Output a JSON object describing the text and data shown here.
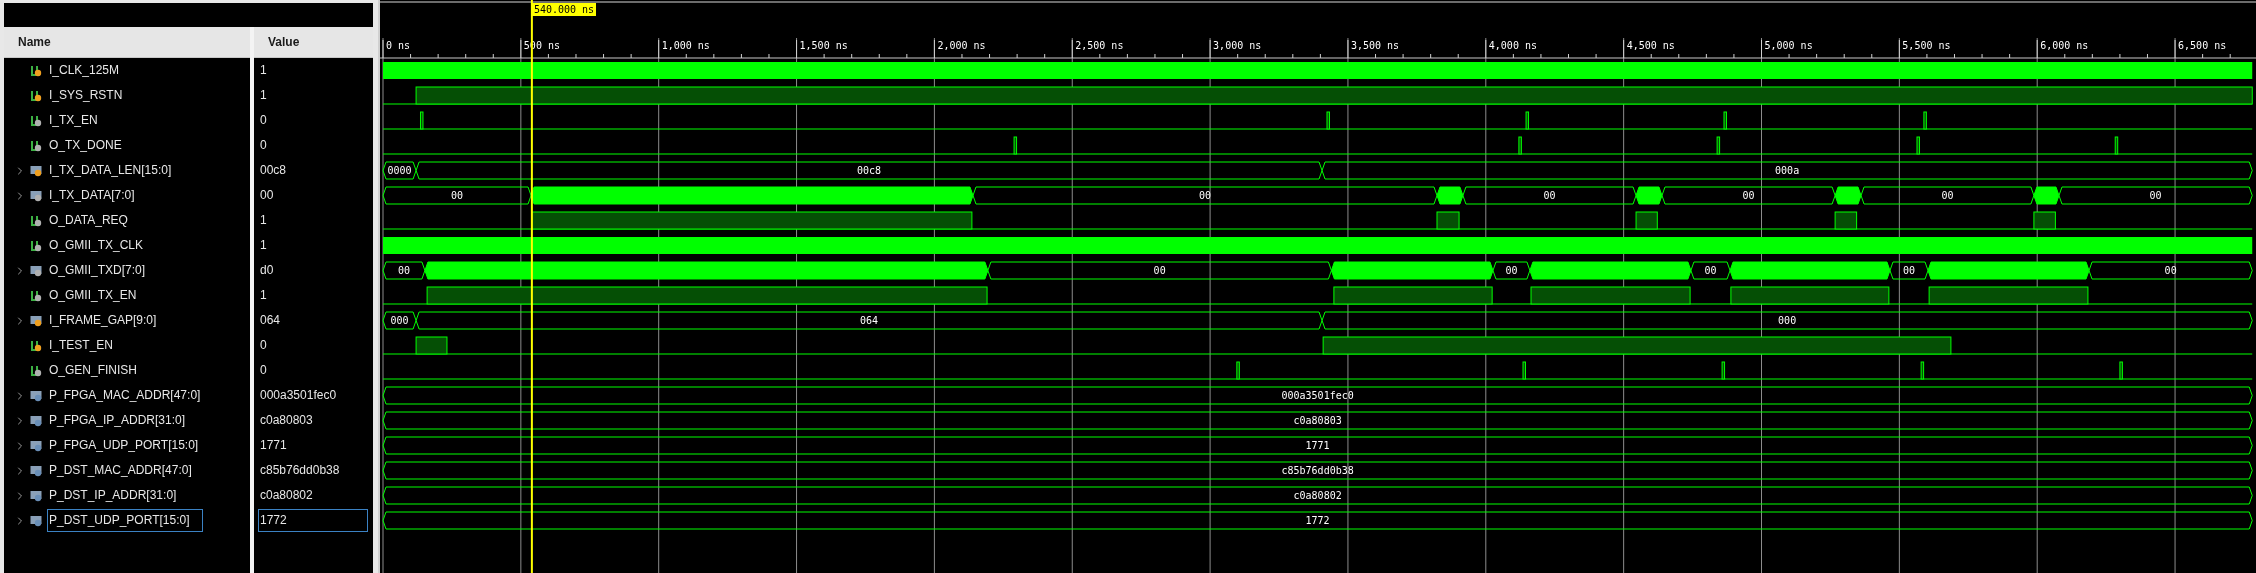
{
  "columns": {
    "name": "Name",
    "value": "Value"
  },
  "cursor": {
    "label": "540.000 ns"
  },
  "ruler": {
    "ticks": [
      "0 ns",
      "500 ns",
      "1,000 ns",
      "1,500 ns",
      "2,000 ns",
      "2,500 ns",
      "3,000 ns",
      "3,500 ns",
      "4,000 ns",
      "4,500 ns",
      "5,000 ns",
      "5,500 ns",
      "6,000 ns",
      "6,500 ns"
    ]
  },
  "signals": [
    {
      "name": "I_CLK_125M",
      "value": "1",
      "kind": "clock",
      "icon": {
        "kind": "input"
      },
      "selected": false
    },
    {
      "name": "I_SYS_RSTN",
      "value": "1",
      "kind": "bit",
      "icon": {
        "kind": "input"
      },
      "selected": false
    },
    {
      "name": "I_TX_EN",
      "value": "0",
      "kind": "bit",
      "icon": {
        "kind": "output"
      },
      "selected": false
    },
    {
      "name": "O_TX_DONE",
      "value": "0",
      "kind": "bit",
      "icon": {
        "kind": "output"
      },
      "selected": false
    },
    {
      "name": "I_TX_DATA_LEN[15:0]",
      "value": "00c8",
      "kind": "bus",
      "icon": {
        "kind": "input"
      },
      "selected": false,
      "bus_labels": [
        "0000",
        "00c8",
        "000a"
      ]
    },
    {
      "name": "I_TX_DATA[7:0]",
      "value": "00",
      "kind": "bus",
      "icon": {
        "kind": "output"
      },
      "selected": false,
      "bus_labels": [
        "00",
        "00",
        "00",
        "00",
        "00",
        "00"
      ]
    },
    {
      "name": "O_DATA_REQ",
      "value": "1",
      "kind": "bit",
      "icon": {
        "kind": "output"
      },
      "selected": false
    },
    {
      "name": "O_GMII_TX_CLK",
      "value": "1",
      "kind": "clock",
      "icon": {
        "kind": "output"
      },
      "selected": false
    },
    {
      "name": "O_GMII_TXD[7:0]",
      "value": "d0",
      "kind": "bus",
      "icon": {
        "kind": "output"
      },
      "selected": false,
      "bus_labels": [
        "00",
        "00",
        "00",
        "00",
        "00",
        "00"
      ]
    },
    {
      "name": "O_GMII_TX_EN",
      "value": "1",
      "kind": "bit",
      "icon": {
        "kind": "output"
      },
      "selected": false
    },
    {
      "name": "I_FRAME_GAP[9:0]",
      "value": "064",
      "kind": "bus",
      "icon": {
        "kind": "input"
      },
      "selected": false,
      "bus_labels": [
        "000",
        "064",
        "000"
      ]
    },
    {
      "name": "I_TEST_EN",
      "value": "0",
      "kind": "bit",
      "icon": {
        "kind": "input"
      },
      "selected": false
    },
    {
      "name": "O_GEN_FINISH",
      "value": "0",
      "kind": "bit",
      "icon": {
        "kind": "output"
      },
      "selected": false
    },
    {
      "name": "P_FPGA_MAC_ADDR[47:0]",
      "value": "000a3501fec0",
      "kind": "bus",
      "icon": {
        "kind": "constant"
      },
      "selected": false,
      "bus_labels": [
        "000a3501fec0"
      ]
    },
    {
      "name": "P_FPGA_IP_ADDR[31:0]",
      "value": "c0a80803",
      "kind": "bus",
      "icon": {
        "kind": "constant"
      },
      "selected": false,
      "bus_labels": [
        "c0a80803"
      ]
    },
    {
      "name": "P_FPGA_UDP_PORT[15:0]",
      "value": "1771",
      "kind": "bus",
      "icon": {
        "kind": "constant"
      },
      "selected": false,
      "bus_labels": [
        "1771"
      ]
    },
    {
      "name": "P_DST_MAC_ADDR[47:0]",
      "value": "c85b76dd0b38",
      "kind": "bus",
      "icon": {
        "kind": "constant"
      },
      "selected": false,
      "bus_labels": [
        "c85b76dd0b38"
      ]
    },
    {
      "name": "P_DST_IP_ADDR[31:0]",
      "value": "c0a80802",
      "kind": "bus",
      "icon": {
        "kind": "constant"
      },
      "selected": false,
      "bus_labels": [
        "c0a80802"
      ]
    },
    {
      "name": "P_DST_UDP_PORT[15:0]",
      "value": "1772",
      "kind": "bus",
      "icon": {
        "kind": "constant"
      },
      "selected": true,
      "bus_labels": [
        "1772"
      ]
    }
  ]
}
